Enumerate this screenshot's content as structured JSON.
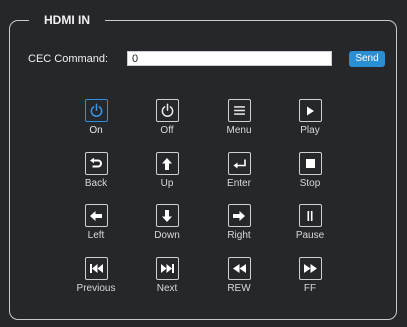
{
  "section": {
    "title": "HDMI IN"
  },
  "cec": {
    "label": "CEC Command:",
    "value": "0",
    "send_label": "Send"
  },
  "colors": {
    "accent": "#2a8ed2",
    "active_border": "#2f8fe0",
    "background": "#26272b"
  },
  "buttons": [
    {
      "label": "On",
      "icon": "power-icon"
    },
    {
      "label": "Off",
      "icon": "power-icon"
    },
    {
      "label": "Menu",
      "icon": "menu-icon"
    },
    {
      "label": "Play",
      "icon": "play-icon"
    },
    {
      "label": "Back",
      "icon": "back-icon"
    },
    {
      "label": "Up",
      "icon": "arrow-up-icon"
    },
    {
      "label": "Enter",
      "icon": "enter-icon"
    },
    {
      "label": "Stop",
      "icon": "stop-icon"
    },
    {
      "label": "Left",
      "icon": "arrow-left-icon"
    },
    {
      "label": "Down",
      "icon": "arrow-down-icon"
    },
    {
      "label": "Right",
      "icon": "arrow-right-icon"
    },
    {
      "label": "Pause",
      "icon": "pause-icon"
    },
    {
      "label": "Previous",
      "icon": "previous-icon"
    },
    {
      "label": "Next",
      "icon": "next-icon"
    },
    {
      "label": "REW",
      "icon": "rewind-icon"
    },
    {
      "label": "FF",
      "icon": "fast-forward-icon"
    }
  ]
}
